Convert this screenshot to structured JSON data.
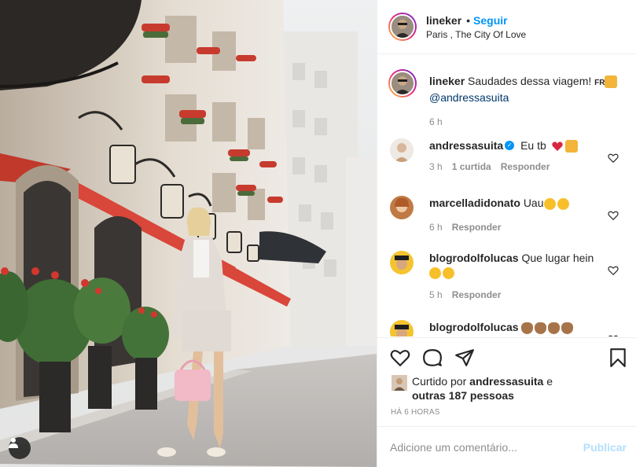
{
  "header": {
    "username": "lineker",
    "separator": "•",
    "follow_label": "Seguir",
    "location": "Paris , The City Of Love"
  },
  "caption": {
    "username": "lineker",
    "text": "Saudades dessa viagem!",
    "inline_tag": "FR",
    "mention": "@andressasuita",
    "time": "6 h"
  },
  "comments": [
    {
      "username": "andressasuita",
      "text": "Eu tb",
      "time": "3 h",
      "likes": "1 curtida",
      "reply": "Responder",
      "verified": true
    },
    {
      "username": "marcelladidonato",
      "text": "Uau",
      "time": "6 h",
      "reply": "Responder"
    },
    {
      "username": "blogrodolfolucas",
      "text": "Que lugar hein",
      "time": "5 h",
      "reply": "Responder"
    },
    {
      "username": "blogrodolfolucas",
      "text": ""
    }
  ],
  "likes": {
    "prefix": "Curtido por",
    "user": "andressasuita",
    "conj": "e",
    "others": "outras 187 pessoas"
  },
  "post_time": "HÁ 6 HORAS",
  "add_comment": {
    "placeholder": "Adicione um comentário...",
    "publish_label": "Publicar"
  },
  "icons": {
    "like": "heart-icon",
    "comment": "comment-icon",
    "share": "share-icon",
    "save": "bookmark-icon",
    "tag": "user-tag-icon"
  },
  "colors": {
    "accent": "#0095f6",
    "publish_disabled": "#b2dffc",
    "muted": "#8e8e8e"
  }
}
